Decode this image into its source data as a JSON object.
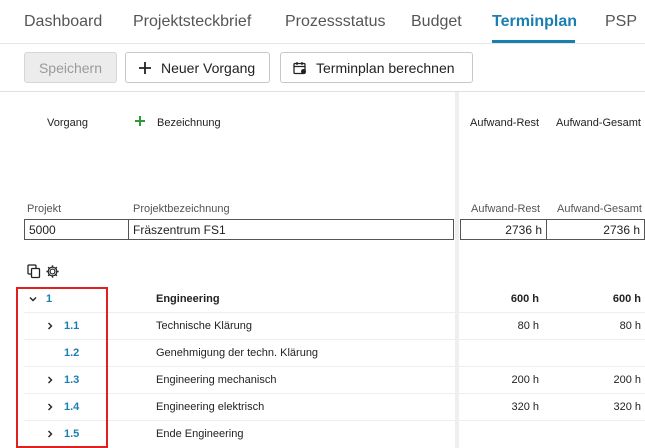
{
  "tabs": [
    {
      "label": "Dashboard"
    },
    {
      "label": "Projektsteckbrief"
    },
    {
      "label": "Prozessstatus"
    },
    {
      "label": "Budget"
    },
    {
      "label": "Terminplan"
    },
    {
      "label": "PSP"
    }
  ],
  "toolbar": {
    "save_label": "Speichern",
    "new_task_label": "Neuer Vorgang",
    "calc_label": "Terminplan berechnen"
  },
  "grid_header": {
    "vorgang": "Vorgang",
    "bezeichnung": "Bezeichnung",
    "aufwand_rest": "Aufwand-Rest",
    "aufwand_gesamt": "Aufwand-Gesamt"
  },
  "project": {
    "label_projekt": "Projekt",
    "label_bezeichnung": "Projektbezeichnung",
    "label_rest": "Aufwand-Rest",
    "label_gesamt": "Aufwand-Gesamt",
    "id": "5000",
    "name": "Fräszentrum FS1",
    "rest": "2736 h",
    "gesamt": "2736 h"
  },
  "rows": [
    {
      "num": "1",
      "name": "Engineering",
      "rest": "600 h",
      "gesamt": "600 h"
    },
    {
      "num": "1.1",
      "name": "Technische Klärung",
      "rest": "80 h",
      "gesamt": "80 h"
    },
    {
      "num": "1.2",
      "name": "Genehmigung der techn. Klärung",
      "rest": "",
      "gesamt": ""
    },
    {
      "num": "1.3",
      "name": "Engineering mechanisch",
      "rest": "200 h",
      "gesamt": "200 h"
    },
    {
      "num": "1.4",
      "name": "Engineering elektrisch",
      "rest": "320 h",
      "gesamt": "320 h"
    },
    {
      "num": "1.5",
      "name": "Ende Engineering",
      "rest": "",
      "gesamt": ""
    }
  ],
  "colors": {
    "accent": "#1a7fb0",
    "highlight": "#e02020",
    "add": "#2e9a3a"
  }
}
